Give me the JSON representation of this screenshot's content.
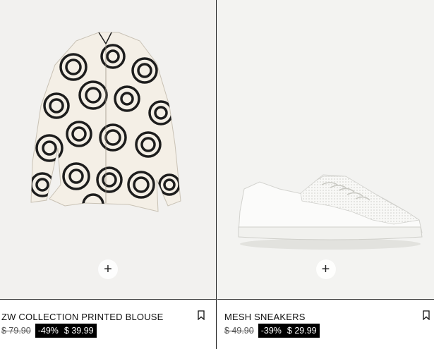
{
  "products": [
    {
      "name": "ZW COLLECTION PRINTED BLOUSE",
      "old_price": "$ 79.90",
      "discount": "-49%",
      "new_price": "$ 39.99",
      "add_label": "+",
      "image_icon": "printed-blouse-image"
    },
    {
      "name": "MESH SNEAKERS",
      "old_price": "$ 49.90",
      "discount": "-39%",
      "new_price": "$ 29.99",
      "add_label": "+",
      "image_icon": "mesh-sneakers-image"
    }
  ],
  "colors": {
    "badge_bg": "#000000",
    "image_bg": "#f2f1ef"
  }
}
